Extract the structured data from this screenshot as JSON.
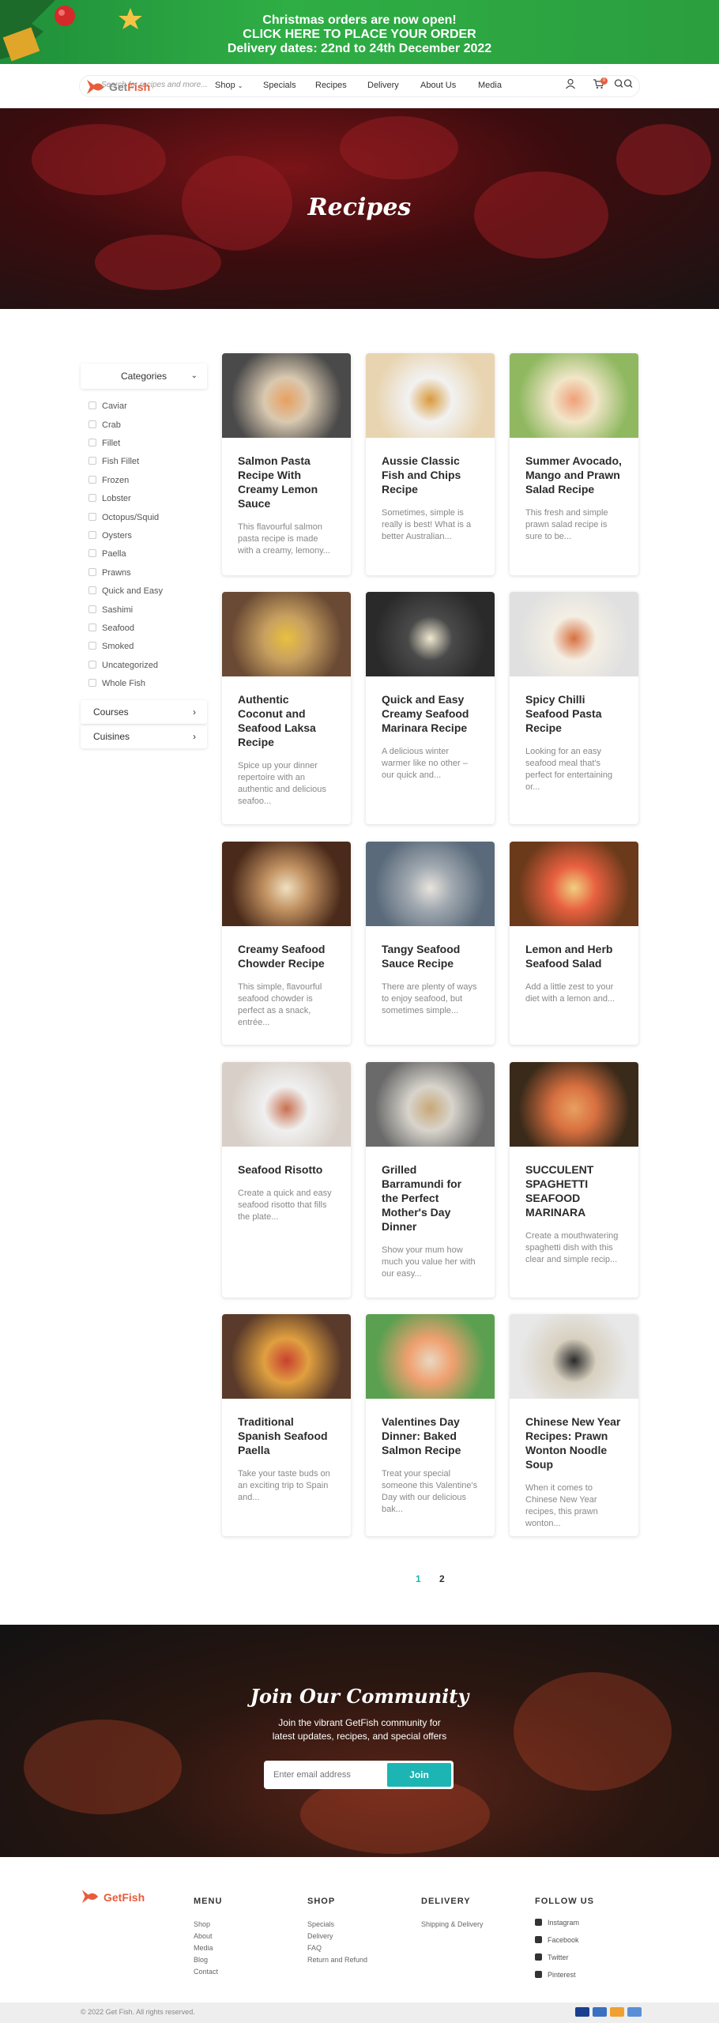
{
  "promo": {
    "line1": "Christmas orders are now open!",
    "line2": "CLICK HERE TO PLACE YOUR ORDER",
    "line3": "Delivery dates: 22nd to 24th December 2022"
  },
  "header": {
    "logo_get": "Get",
    "logo_fish": "Fish",
    "search_placeholder": "Search for recipes and more...",
    "nav": [
      "Shop",
      "Specials",
      "Recipes",
      "Delivery",
      "About Us",
      "Media"
    ],
    "cart_count": "0"
  },
  "hero": {
    "title": "Recipes"
  },
  "sidebar": {
    "categories_label": "Categories",
    "categories": [
      "Caviar",
      "Crab",
      "Fillet",
      "Fish Fillet",
      "Frozen",
      "Lobster",
      "Octopus/Squid",
      "Oysters",
      "Paella",
      "Prawns",
      "Quick and Easy",
      "Sashimi",
      "Seafood",
      "Smoked",
      "Uncategorized",
      "Whole Fish"
    ],
    "courses_label": "Courses",
    "cuisines_label": "Cuisines"
  },
  "recipes": [
    {
      "title": "Salmon Pasta Recipe With Creamy Lemon Sauce",
      "desc": "This flavourful salmon pasta recipe is made with a creamy, lemony..."
    },
    {
      "title": "Aussie Classic Fish and Chips Recipe",
      "desc": "Sometimes, simple is really is best! What is a better Australian..."
    },
    {
      "title": "Summer Avocado, Mango and Prawn Salad Recipe",
      "desc": "This fresh and simple prawn salad recipe is sure to be..."
    },
    {
      "title": "Authentic Coconut and Seafood Laksa Recipe",
      "desc": "Spice up your dinner repertoire with an authentic and delicious seafoo..."
    },
    {
      "title": "Quick and Easy Creamy Seafood Marinara Recipe",
      "desc": "A delicious winter warmer like no other – our quick and..."
    },
    {
      "title": "Spicy Chilli Seafood Pasta Recipe",
      "desc": "Looking for an easy seafood meal that's perfect for entertaining or..."
    },
    {
      "title": "Creamy Seafood Chowder Recipe",
      "desc": "This simple, flavourful seafood chowder is perfect as a snack, entrée..."
    },
    {
      "title": "Tangy Seafood Sauce Recipe",
      "desc": "There are plenty of ways to enjoy seafood, but sometimes simple..."
    },
    {
      "title": "Lemon and Herb Seafood Salad",
      "desc": "Add a little zest to your diet with a lemon and..."
    },
    {
      "title": "Seafood Risotto",
      "desc": "Create a quick and easy seafood risotto that fills the plate..."
    },
    {
      "title": "Grilled Barramundi for the Perfect Mother's Day Dinner",
      "desc": "Show your mum how much you value her with our easy..."
    },
    {
      "title": "SUCCULENT SPAGHETTI SEAFOOD MARINARA",
      "desc": "Create a mouthwatering spaghetti dish with this clear and simple recip..."
    },
    {
      "title": "Traditional Spanish Seafood Paella",
      "desc": "Take your taste buds on an exciting trip to Spain and..."
    },
    {
      "title": "Valentines Day Dinner: Baked Salmon Recipe",
      "desc": "Treat your special someone this Valentine's Day with our delicious bak..."
    },
    {
      "title": "Chinese New Year Recipes: Prawn Wonton Noodle Soup",
      "desc": "When it comes to Chinese New Year recipes, this prawn wonton..."
    }
  ],
  "pagination": {
    "pages": [
      "1",
      "2"
    ],
    "current": "1"
  },
  "community": {
    "title": "Join Our Community",
    "sub1": "Join the vibrant GetFish community for",
    "sub2": "latest updates, recipes, and special offers",
    "email_placeholder": "Enter email address",
    "join_label": "Join"
  },
  "footer": {
    "logo_get": "Get",
    "logo_fish": "Fish",
    "menu_title": "MENU",
    "menu": [
      "Shop",
      "About",
      "Media",
      "Blog",
      "Contact"
    ],
    "shop_title": "SHOP",
    "shop": [
      "Specials",
      "Delivery",
      "FAQ",
      "Return and Refund"
    ],
    "delivery_title": "DELIVERY",
    "delivery": [
      "Shipping & Delivery"
    ],
    "follow_title": "FOLLOW US",
    "social": [
      "Instagram",
      "Facebook",
      "Twitter",
      "Pinterest"
    ],
    "copyright": "© 2022 Get Fish. All rights reserved."
  },
  "colors": {
    "accent_teal": "#1cb5b3",
    "brand_red": "#e85c3a",
    "promo_green": "#2fae45"
  }
}
